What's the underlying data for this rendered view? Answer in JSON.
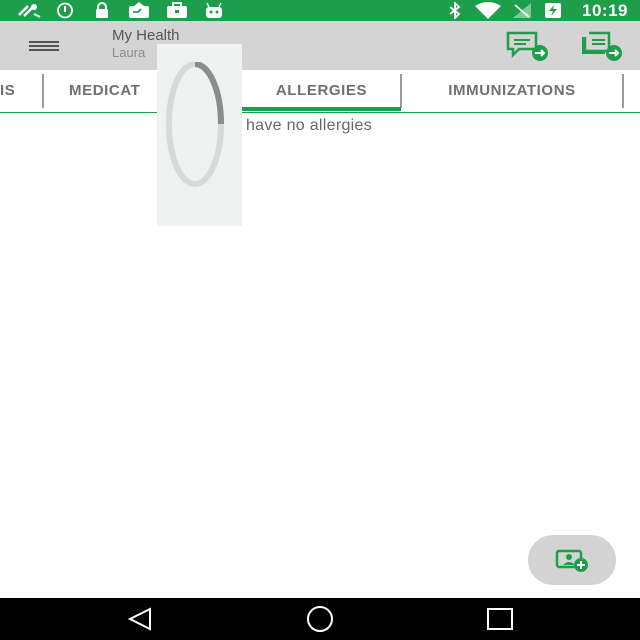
{
  "status_bar": {
    "time": "10:19",
    "left_icons": [
      "satellite-icon",
      "circle-info-icon",
      "lock-icon",
      "message-icon",
      "briefcase-icon",
      "android-icon"
    ],
    "right_icons": [
      "bluetooth-icon",
      "wifi-icon",
      "signal-icon",
      "battery-charging-icon"
    ]
  },
  "app_bar": {
    "title": "My Health",
    "subtitle": "Laura",
    "actions": [
      "send-message-icon",
      "send-document-icon"
    ]
  },
  "tabs": [
    {
      "label": "IS",
      "selected": false
    },
    {
      "label": "MEDICAT",
      "selected": false
    },
    {
      "label": "ALLERGIES",
      "selected": true
    },
    {
      "label": "IMMUNIZATIONS",
      "selected": false
    }
  ],
  "content": {
    "empty_message": "u have no allergies"
  },
  "fab": {
    "icon": "add-contact-card-icon"
  },
  "nav_bar": {
    "buttons": [
      "back-icon",
      "home-icon",
      "recents-icon"
    ]
  },
  "colors": {
    "accent": "#1e9e4a",
    "app_bar": "#d4d4d4",
    "tab_text": "#6f6f6f",
    "nav_bar": "#000000"
  }
}
